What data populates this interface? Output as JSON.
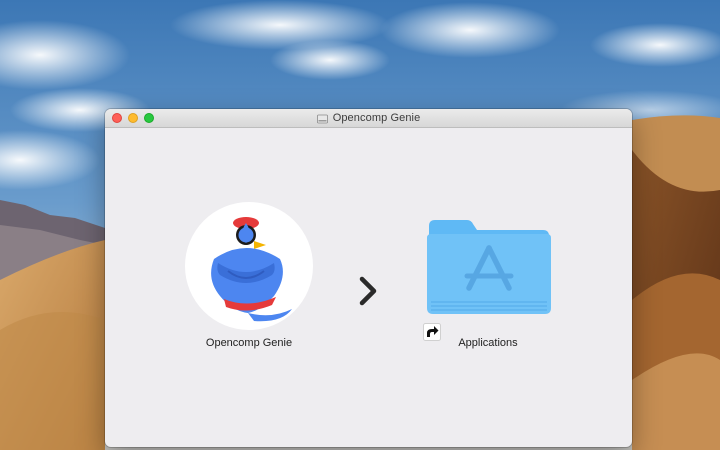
{
  "window": {
    "title": "Opencomp Genie"
  },
  "items": {
    "app": {
      "label": "Opencomp Genie",
      "icon": "genie-app-icon"
    },
    "arrow": {
      "icon": "chevron-right-icon"
    },
    "folder": {
      "label": "Applications",
      "icon": "applications-folder-icon"
    }
  },
  "colors": {
    "close": "#fe5f57",
    "minimize": "#febb2e",
    "zoom": "#28c840",
    "window_bg": "#eeedf0",
    "folder_blue": "#5fb9f5",
    "genie_blue": "#4d86f0"
  }
}
